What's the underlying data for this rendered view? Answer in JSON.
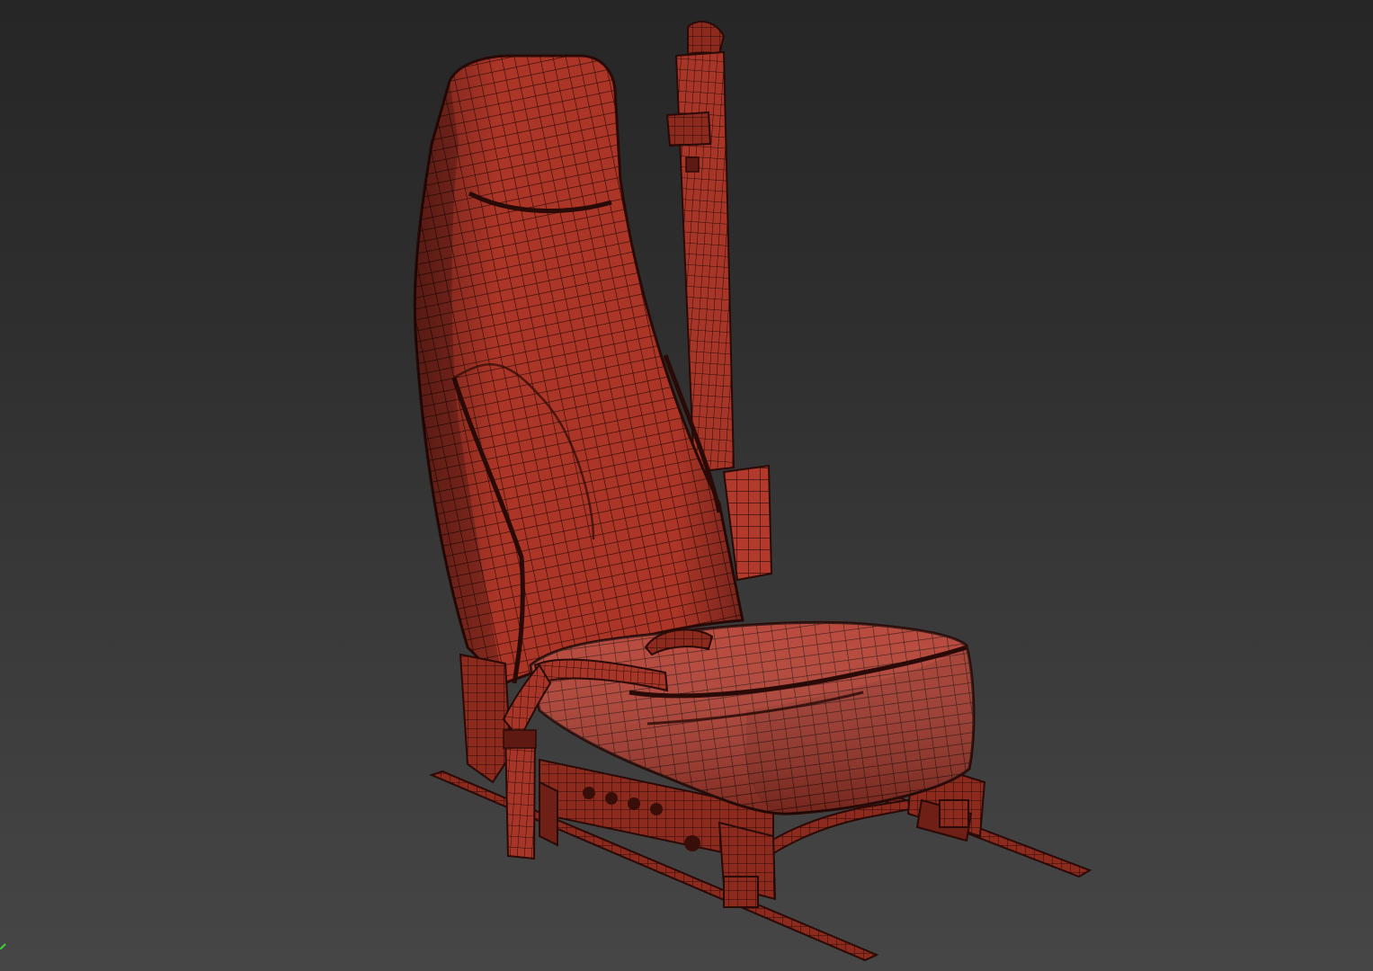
{
  "viewport": {
    "background_top": "#262626",
    "background_bottom": "#464646",
    "shading_mode": "wireframe-on-shaded"
  },
  "model": {
    "subject": "car-seat-with-seatbelt",
    "surface_color": "#b23a2c",
    "surface_dark_color": "#7a2218",
    "wire_color": "#2a0a06",
    "highlight_color": "#d86a58"
  },
  "gizmo": {
    "icon": "axis-gizmo-icon",
    "color": "#3ad33a"
  }
}
